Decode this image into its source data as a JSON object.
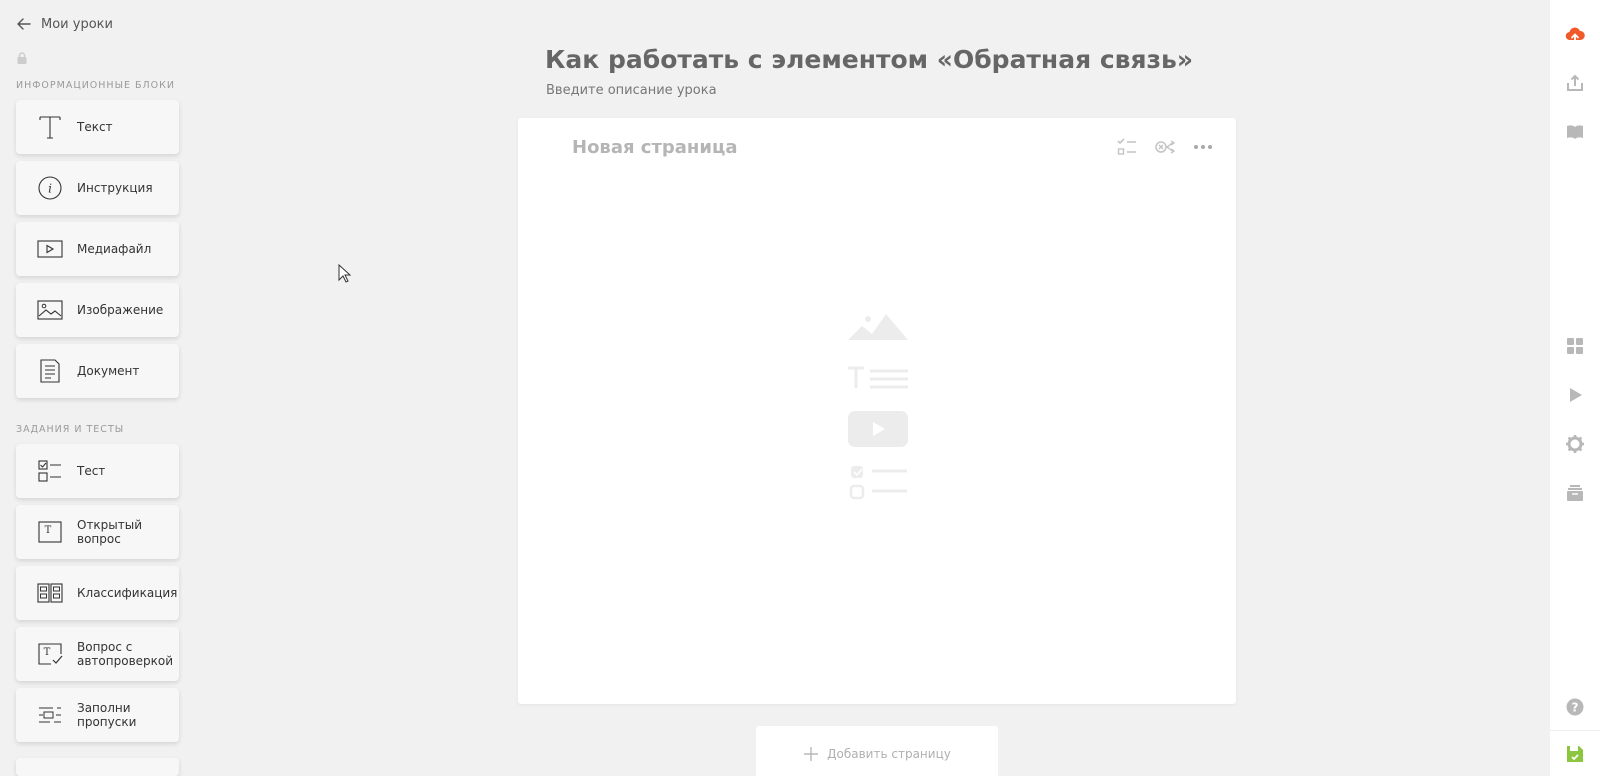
{
  "sidebar": {
    "back_label": "Мои уроки",
    "sections": [
      {
        "title": "Информационные блоки"
      },
      {
        "title": "Задания и тесты"
      }
    ],
    "items": [
      {
        "label": "Текст",
        "icon": "text-icon"
      },
      {
        "label": "Инструкция",
        "icon": "info-icon"
      },
      {
        "label": "Медиафайл",
        "icon": "media-icon"
      },
      {
        "label": "Изображение",
        "icon": "image-icon"
      },
      {
        "label": "Документ",
        "icon": "document-icon"
      },
      {
        "label": "Тест",
        "icon": "test-icon"
      },
      {
        "label": "Открытый вопрос",
        "icon": "open-question-icon"
      },
      {
        "label": "Классификация",
        "icon": "classification-icon"
      },
      {
        "label": "Вопрос с автопроверкой",
        "icon": "auto-check-icon"
      },
      {
        "label": "Заполни пропуски",
        "icon": "fill-gaps-icon"
      }
    ]
  },
  "main": {
    "title": "Как работать с элементом «Обратная связь»",
    "description": "Введите описание урока",
    "page": {
      "title": "Новая страница"
    },
    "add_page_label": "Добавить страницу"
  },
  "colors": {
    "accent_orange": "#f05a28",
    "save_green": "#8cc63f",
    "rail_icon": "#b8b8b8"
  }
}
